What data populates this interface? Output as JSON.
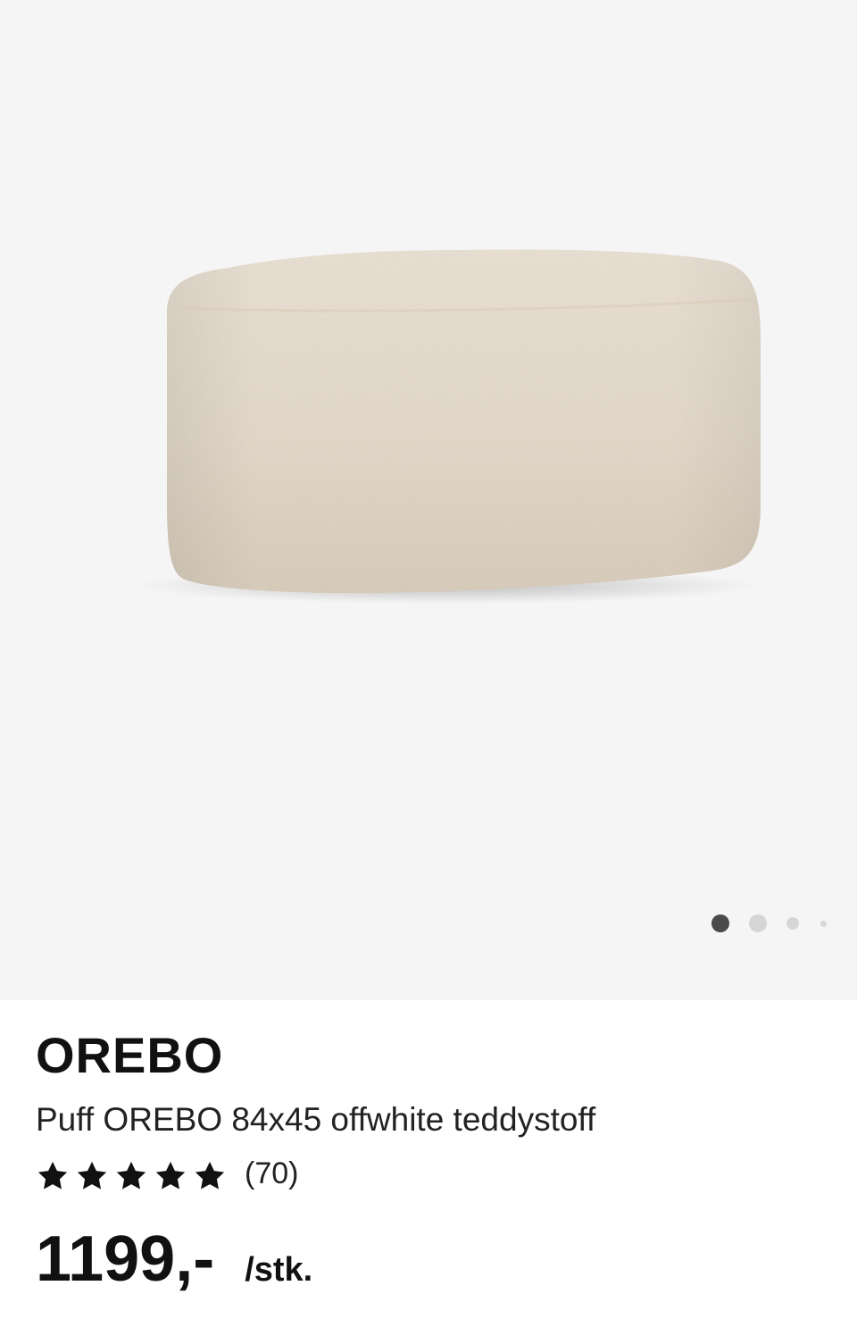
{
  "gallery": {
    "image_alt": "Puff OREBO offwhite teddystoff",
    "slide_count": 4,
    "active_slide": 1
  },
  "product": {
    "brand": "OREBO",
    "description": "Puff OREBO 84x45 offwhite teddystoff",
    "rating": 5,
    "rating_max": 5,
    "review_count": "(70)",
    "price": "1199,-",
    "unit": "/stk."
  },
  "colors": {
    "gallery_bg": "#f5f5f5",
    "fabric": "#eee4d6",
    "star": "#111111",
    "active_dot": "#4a4a4a",
    "inactive_dot": "#d6d6d6"
  }
}
